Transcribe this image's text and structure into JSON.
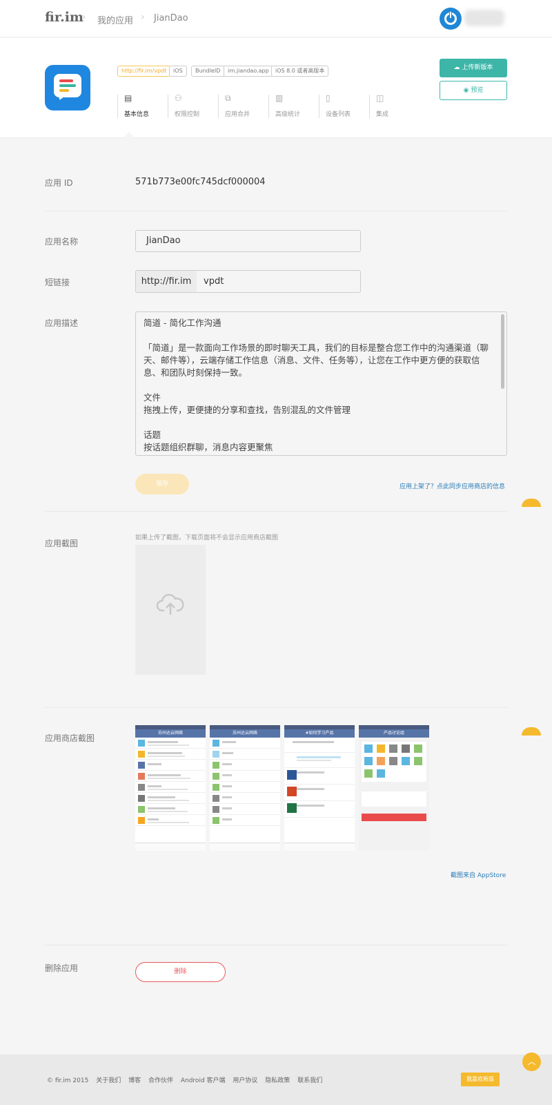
{
  "topbar": {
    "logo": "fir.im",
    "breadcrumb": [
      "我的应用",
      "JianDao"
    ]
  },
  "app": {
    "tags": {
      "short_url": "http://fir.im/vpdt",
      "platform": "iOS",
      "bundle_label": "BundleID",
      "bundle_id": "im.jiandao.app",
      "min_os": "iOS 8.0 或者高版本"
    },
    "tabs": [
      {
        "label": "基本信息",
        "icon": "document-icon"
      },
      {
        "label": "权限控制",
        "icon": "users-icon"
      },
      {
        "label": "应用合并",
        "icon": "merge-icon"
      },
      {
        "label": "高级统计",
        "icon": "bar-chart-icon"
      },
      {
        "label": "设备列表",
        "icon": "phone-icon"
      },
      {
        "label": "集成",
        "icon": "box-icon"
      }
    ],
    "upload_button": "上传新版本",
    "preview_button": "预览"
  },
  "form": {
    "app_id_label": "应用 ID",
    "app_id_value": "571b773e00fc745dcf000004",
    "name_label": "应用名称",
    "name_value": "JianDao",
    "short_link_label": "短链接",
    "short_link_prefix": "http://fir.im",
    "short_link_value": "vpdt",
    "desc_label": "应用描述",
    "desc_lines": [
      "简道 - 简化工作沟通",
      "",
      "「简道」是一款面向工作场景的即时聊天工具，我们的目标是整合您工作中的沟通渠道（聊天、邮件等），云端存储工作信息（消息、文件、任务等），让您在工作中更方便的获取信息、和团队时刻保持一致。",
      "",
      "文件",
      "拖拽上传，更便捷的分享和查找，告别混乱的文件管理",
      "",
      "话题",
      "按话题组织群聊，消息内容更聚焦"
    ],
    "save_button": "保存",
    "sync_link": "应用上架了？点此同步应用商店的信息",
    "screenshot_label": "应用截图",
    "screenshot_hint": "如果上传了截图，下载页面将不会显示应用商店截图",
    "store_screenshot_label": "应用商店截图",
    "store_screens": [
      {
        "title": "苏州达云网络"
      },
      {
        "title": "苏州达云网络"
      },
      {
        "title": "#如何学习产品"
      },
      {
        "title": "产品讨论组"
      }
    ],
    "store_source_link": "截图来自 AppStore",
    "delete_label": "删除应用",
    "delete_button": "删除"
  },
  "footer": {
    "links": [
      "© fir.im 2015",
      "关于我们",
      "博客",
      "合作伙伴",
      "Android 客户端",
      "用户协议",
      "隐私政策",
      "联系我们"
    ],
    "feedback_button": "我喜欢新版"
  },
  "colors": {
    "accent": "#3db6a8",
    "warning": "#f5b92e",
    "danger": "#e85a5a",
    "link": "#2a7db8"
  }
}
